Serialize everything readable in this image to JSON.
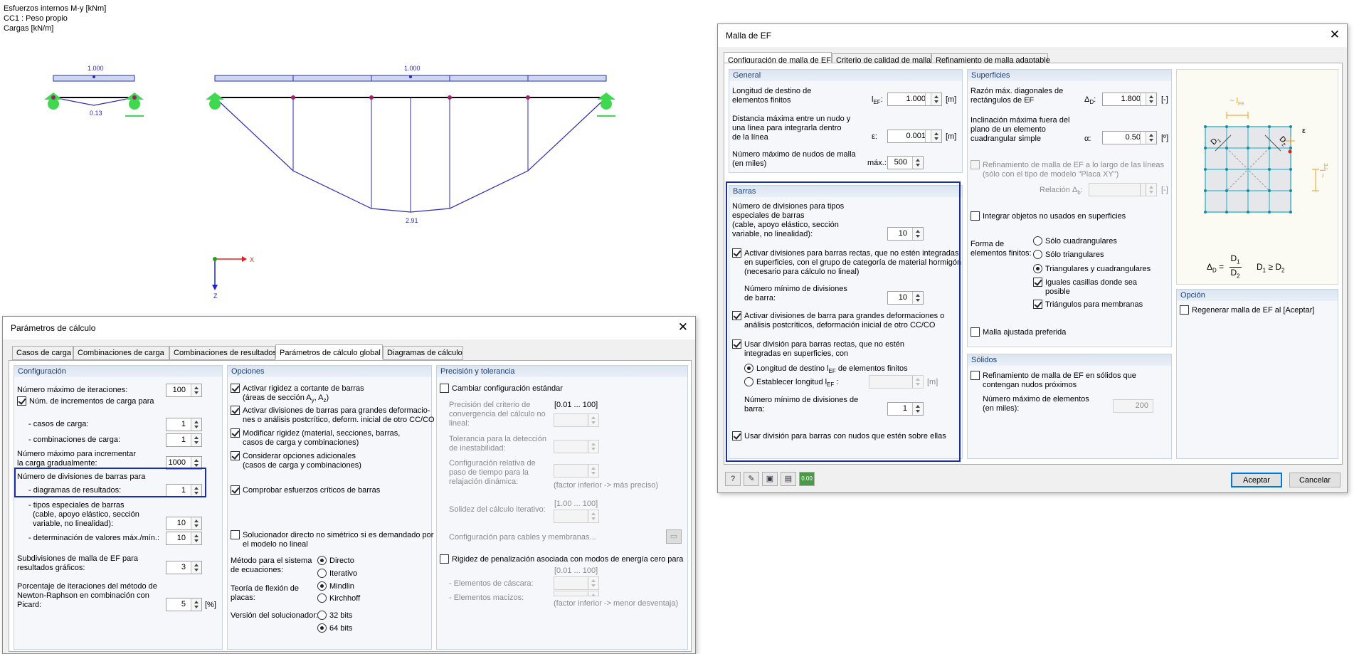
{
  "model": {
    "header": [
      "Esfuerzos internos M-y [kNm]",
      "CC1 : Peso propio",
      "Cargas [kN/m]"
    ],
    "left_load_value": "1.000",
    "left_moment_value": "0.13",
    "right_load_value": "1.000",
    "right_moment_value": "2.91",
    "axis_x": "X",
    "axis_z": "Z"
  },
  "calc": {
    "title": "Parámetros de cálculo",
    "tabs": [
      "Casos de carga",
      "Combinaciones de carga",
      "Combinaciones de resultados",
      "Parámetros de cálculo global",
      "Diagramas de cálculo"
    ],
    "config": {
      "header": "Configuración",
      "max_iter_label": "Número máximo de iteraciones:",
      "max_iter": "100",
      "num_incr_label": "Núm. de incrementos de carga para",
      "casos_label": "- casos de carga:",
      "casos": "1",
      "combis_label": "- combinaciones de carga:",
      "combis": "1",
      "max_incr_label1": "Número máximo para incrementar",
      "max_incr_label2": "la carga gradualmente:",
      "max_incr": "1000",
      "div_barras_label": "Número de divisiones de barras para",
      "diag_label": "- diagramas de resultados:",
      "diag": "1",
      "tipos_l1": "- tipos especiales de barras",
      "tipos_l2": "(cable, apoyo elástico, sección",
      "tipos_l3": "variable, no linealidad):",
      "tipos": "10",
      "det_label": "- determinación de valores máx./mín.:",
      "det": "10",
      "sub_l1": "Subdivisiones de malla de EF para",
      "sub_l2": "resultados gráficos:",
      "sub": "3",
      "pct_l1": "Porcentaje de iteraciones del método de",
      "pct_l2": "Newton-Raphson en combinación con",
      "pct_l3": "Picard:",
      "pct": "5",
      "pct_unit": "[%]"
    },
    "opciones": {
      "header": "Opciones",
      "o1a": "Activar rigidez a cortante de barras",
      "o1b": "(áreas de sección A",
      "o1b_sub1": "y",
      "o1b_mid": ", A",
      "o1b_sub2": "z",
      "o1b_end": ")",
      "o2a": "Activar divisiones de barras para grandes deformacio-",
      "o2b": "nes o análisis postcrítico, deform. inicial de otro CC/CO",
      "o3a": "Modificar rigidez (material, secciones, barras,",
      "o3b": "casos de carga y combinaciones)",
      "o4a": "Considerar opciones adicionales",
      "o4b": "(casos de carga y combinaciones)",
      "o5": "Comprobar esfuerzos críticos de barras",
      "o6a": "Solucionador directo no simétrico si es demandado por",
      "o6b": "el modelo no lineal",
      "metodo_l1": "Método para el sistema",
      "metodo_l2": "de ecuaciones:",
      "directo": "Directo",
      "iterativo": "Iterativo",
      "teoria_l1": "Teoría de flexión de",
      "teoria_l2": "placas:",
      "mindlin": "Mindlin",
      "kirchhoff": "Kirchhoff",
      "version": "Versión del solucionador:",
      "b32": "32 bits",
      "b64": "64 bits"
    },
    "precision": {
      "header": "Precisión y tolerancia",
      "cambiar": "Cambiar configuración estándar",
      "p1a": "Precisión del criterio de",
      "p1b": "convergencia del cálculo no",
      "p1c": "lineal:",
      "range1": "[0.01 ... 100]",
      "p2a": "Tolerancia para la detección",
      "p2b": "de inestabilidad:",
      "p3a": "Configuración relativa de",
      "p3b": "paso de tiempo para la",
      "p3c": "relajación dinámica:",
      "hint1": "(factor inferior -> más preciso)",
      "range2": "[1.00 ... 100]",
      "solidez": "Solidez del cálculo iterativo:",
      "cables": "Configuración para cables y membranas...",
      "rigidez": "Rigidez de penalización asociada con modos de energía cero para",
      "range3": "[0.01 ... 100]",
      "cascara": "- Elementos de cáscara:",
      "macizos": "- Elementos macizos:",
      "hint2": "(factor inferior -> menor desventaja)"
    }
  },
  "mesh": {
    "title": "Malla de EF",
    "tabs": [
      "Configuración de malla de EF",
      "Criterio de calidad de malla",
      "Refinamiento de malla adaptable"
    ],
    "general": {
      "header": "General",
      "long_l1": "Longitud de destino de",
      "long_l2": "elementos finitos",
      "long_sym": "l",
      "long_sub": "EF",
      "long_colon": ":",
      "long_val": "1.000",
      "long_unit": "[m]",
      "dist_l1": "Distancia máxima entre un nudo y",
      "dist_l2": "una línea para integrarla dentro",
      "dist_l3": "de la línea",
      "dist_sym": "ε:",
      "dist_val": "0.001",
      "dist_unit": "[m]",
      "num_l1": "Número máximo de nudos de malla",
      "num_l2": "(en miles)",
      "num_sym": "máx.:",
      "num_val": "500"
    },
    "barras": {
      "header": "Barras",
      "b1": "Número de divisiones para tipos",
      "b2": "especiales de barras",
      "b3": "(cable, apoyo elástico, sección",
      "b4": "variable, no linealidad):",
      "b_val": "10",
      "act1": "Activar divisiones para barras rectas, que no estén integradas",
      "act2": "en superficies, con el grupo de categoría de material hormigón",
      "act3": "(necesario para cálculo no lineal)",
      "min1": "Número mínimo de divisiones",
      "min2": "de barra:",
      "min_val": "10",
      "gd1": "Activar divisiones de barra para grandes deformaciones o",
      "gd2": "análisis postcríticos, deformación inicial de otro CC/CO",
      "ud1": "Usar división para barras rectas, que no estén",
      "ud2": "integradas en superficies, con",
      "r1": "Longitud de destino l",
      "r1_sub": "EF",
      "r1_end": " de elementos finitos",
      "r2": "Establecer longitud l",
      "r2_sub": "EF",
      "r2_end": " :",
      "r2_unit": "[m]",
      "nm1": "Número mínimo de divisiones de",
      "nm2": "barra:",
      "nm_val": "1",
      "un": "Usar división para barras con nudos que estén sobre ellas"
    },
    "superficies": {
      "header": "Superficies",
      "raz1": "Razón máx. diagonales de",
      "raz2": "rectángulos de EF",
      "raz_sym": "Δ",
      "raz_sub": "D",
      "raz_colon": ":",
      "raz_val": "1.800",
      "raz_unit": "[-]",
      "inc1": "Inclinación máxima fuera del",
      "inc2": "plano de un elemento",
      "inc3": "cuadrangular simple",
      "inc_sym": "α:",
      "inc_val": "0.50",
      "inc_unit": "[º]",
      "ref1": "Refinamiento de malla de EF a lo largo de las líneas",
      "ref2": "(sólo con el tipo de modelo \"Placa XY\")",
      "rel": "Relación Δ",
      "rel_sub": "b",
      "rel_colon": ":",
      "rel_unit": "[-]",
      "integrar": "Integrar objetos no usados en superficies",
      "forma1": "Forma de",
      "forma2": "elementos finitos:",
      "f_cuad": "Sólo cuadrangulares",
      "f_tri": "Sólo triangulares",
      "f_tc": "Triangulares y cuadrangulares",
      "iguales1": "Iguales casillas donde sea",
      "iguales2": "posible",
      "tri_mem": "Triángulos para membranas",
      "ajustada": "Malla ajustada preferida"
    },
    "figure": {
      "lfe": "~ l",
      "lfe_sub": "FE",
      "eps": "ε",
      "d1": "D",
      "d1_sub": "1",
      "d2": "D",
      "d2_sub": "2",
      "side_l": "~ l",
      "side_sub": "FE",
      "f_delta": "Δ",
      "f_delta_sub": "D",
      "f_eq": "=",
      "f_rel": "D",
      "f_rel_sub1": "1",
      "f_ge": " ≥ D",
      "f_rel_sub2": "2"
    },
    "opcion": {
      "header": "Opción",
      "regen": "Regenerar malla de EF al [Aceptar]"
    },
    "solidos": {
      "header": "Sólidos",
      "s1": "Refinamiento de malla de EF en sólidos que",
      "s2": "contengan nudos próximos",
      "n1": "Número  máximo de elementos",
      "n2": "(en miles):",
      "n_val": "200"
    },
    "footer": {
      "icon1": "?",
      "icon2": "✎",
      "icon3": "▣",
      "icon4": "▤",
      "icon5": "0.00",
      "ok": "Aceptar",
      "cancel": "Cancelar"
    }
  },
  "colors": {
    "accent": "#0078d7",
    "highlight": "#1a2ea8",
    "group_head": "#1f3f7a",
    "diagram": "#2b2bb8",
    "support": "#3fd94f"
  }
}
